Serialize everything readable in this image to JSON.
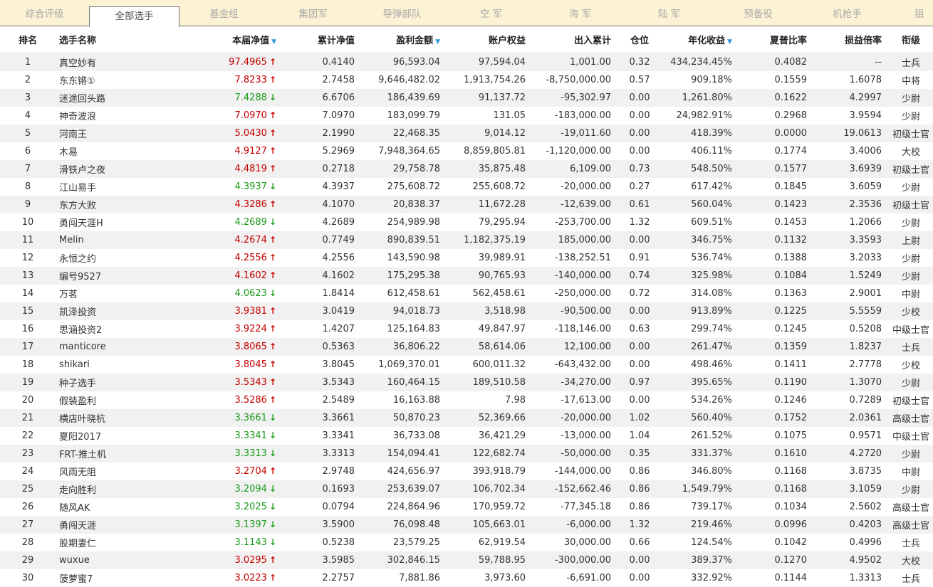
{
  "tabs": [
    {
      "label": "综合评级",
      "active": false
    },
    {
      "label": "全部选手",
      "active": true
    },
    {
      "label": "基金组",
      "active": false
    },
    {
      "label": "集团军",
      "active": false
    },
    {
      "label": "导弹部队",
      "active": false
    },
    {
      "label": "空 军",
      "active": false
    },
    {
      "label": "海 军",
      "active": false
    },
    {
      "label": "陆 军",
      "active": false
    },
    {
      "label": "预备役",
      "active": false
    },
    {
      "label": "机枪手",
      "active": false
    },
    {
      "label": "狙",
      "active": false
    }
  ],
  "table": {
    "columns": [
      "排名",
      "选手名称",
      "本届净值",
      "累计净值",
      "盈利金额",
      "账户权益",
      "出入累计",
      "仓位",
      "年化收益",
      "夏普比率",
      "损益倍率",
      "衔级"
    ],
    "sort_icon": "▼",
    "rows": [
      {
        "rank": "1",
        "name": "真空妙有",
        "nav": "97.4965",
        "dir": "up",
        "cum_nav": "0.4140",
        "profit": "96,593.04",
        "equity": "97,594.04",
        "flow": "1,001.00",
        "position": "0.32",
        "annual": "434,234.45%",
        "sharpe": "0.4082",
        "ratio": "--",
        "grade": "士兵"
      },
      {
        "rank": "2",
        "name": "东东锵①",
        "nav": "7.8233",
        "dir": "up",
        "cum_nav": "2.7458",
        "profit": "9,646,482.02",
        "equity": "1,913,754.26",
        "flow": "-8,750,000.00",
        "position": "0.57",
        "annual": "909.18%",
        "sharpe": "0.1559",
        "ratio": "1.6078",
        "grade": "中将"
      },
      {
        "rank": "3",
        "name": "迷途回头路",
        "nav": "7.4288",
        "dir": "down",
        "cum_nav": "6.6706",
        "profit": "186,439.69",
        "equity": "91,137.72",
        "flow": "-95,302.97",
        "position": "0.00",
        "annual": "1,261.80%",
        "sharpe": "0.1622",
        "ratio": "4.2997",
        "grade": "少尉"
      },
      {
        "rank": "4",
        "name": "神奇波浪",
        "nav": "7.0970",
        "dir": "up",
        "cum_nav": "7.0970",
        "profit": "183,099.79",
        "equity": "131.05",
        "flow": "-183,000.00",
        "position": "0.00",
        "annual": "24,982.91%",
        "sharpe": "0.2968",
        "ratio": "3.9594",
        "grade": "少尉"
      },
      {
        "rank": "5",
        "name": "河南王",
        "nav": "5.0430",
        "dir": "up",
        "cum_nav": "2.1990",
        "profit": "22,468.35",
        "equity": "9,014.12",
        "flow": "-19,011.60",
        "position": "0.00",
        "annual": "418.39%",
        "sharpe": "0.0000",
        "ratio": "19.0613",
        "grade": "初级士官"
      },
      {
        "rank": "6",
        "name": "木易",
        "nav": "4.9127",
        "dir": "up",
        "cum_nav": "5.2969",
        "profit": "7,948,364.65",
        "equity": "8,859,805.81",
        "flow": "-1,120,000.00",
        "position": "0.00",
        "annual": "406.11%",
        "sharpe": "0.1774",
        "ratio": "3.4006",
        "grade": "大校"
      },
      {
        "rank": "7",
        "name": "滑铁卢之夜",
        "nav": "4.4819",
        "dir": "up",
        "cum_nav": "0.2718",
        "profit": "29,758.78",
        "equity": "35,875.48",
        "flow": "6,109.00",
        "position": "0.73",
        "annual": "548.50%",
        "sharpe": "0.1577",
        "ratio": "3.6939",
        "grade": "初级士官"
      },
      {
        "rank": "8",
        "name": "江山易手",
        "nav": "4.3937",
        "dir": "down",
        "cum_nav": "4.3937",
        "profit": "275,608.72",
        "equity": "255,608.72",
        "flow": "-20,000.00",
        "position": "0.27",
        "annual": "617.42%",
        "sharpe": "0.1845",
        "ratio": "3.6059",
        "grade": "少尉"
      },
      {
        "rank": "9",
        "name": "东方大败",
        "nav": "4.3286",
        "dir": "up",
        "cum_nav": "4.1070",
        "profit": "20,838.37",
        "equity": "11,672.28",
        "flow": "-12,639.00",
        "position": "0.61",
        "annual": "560.04%",
        "sharpe": "0.1423",
        "ratio": "2.3536",
        "grade": "初级士官"
      },
      {
        "rank": "10",
        "name": "勇闯天涯H",
        "nav": "4.2689",
        "dir": "down",
        "cum_nav": "4.2689",
        "profit": "254,989.98",
        "equity": "79,295.94",
        "flow": "-253,700.00",
        "position": "1.32",
        "annual": "609.51%",
        "sharpe": "0.1453",
        "ratio": "1.2066",
        "grade": "少尉"
      },
      {
        "rank": "11",
        "name": "Melin",
        "nav": "4.2674",
        "dir": "up",
        "cum_nav": "0.7749",
        "profit": "890,839.51",
        "equity": "1,182,375.19",
        "flow": "185,000.00",
        "position": "0.00",
        "annual": "346.75%",
        "sharpe": "0.1132",
        "ratio": "3.3593",
        "grade": "上尉"
      },
      {
        "rank": "12",
        "name": "永恒之约",
        "nav": "4.2556",
        "dir": "up",
        "cum_nav": "4.2556",
        "profit": "143,590.98",
        "equity": "39,989.91",
        "flow": "-138,252.51",
        "position": "0.91",
        "annual": "536.74%",
        "sharpe": "0.1388",
        "ratio": "3.2033",
        "grade": "少尉"
      },
      {
        "rank": "13",
        "name": "编号9527",
        "nav": "4.1602",
        "dir": "up",
        "cum_nav": "4.1602",
        "profit": "175,295.38",
        "equity": "90,765.93",
        "flow": "-140,000.00",
        "position": "0.74",
        "annual": "325.98%",
        "sharpe": "0.1084",
        "ratio": "1.5249",
        "grade": "少尉"
      },
      {
        "rank": "14",
        "name": "万茗",
        "nav": "4.0623",
        "dir": "down",
        "cum_nav": "1.8414",
        "profit": "612,458.61",
        "equity": "562,458.61",
        "flow": "-250,000.00",
        "position": "0.72",
        "annual": "314.08%",
        "sharpe": "0.1363",
        "ratio": "2.9001",
        "grade": "中尉"
      },
      {
        "rank": "15",
        "name": "凯泽投资",
        "nav": "3.9381",
        "dir": "up",
        "cum_nav": "3.0419",
        "profit": "94,018.73",
        "equity": "3,518.98",
        "flow": "-90,500.00",
        "position": "0.00",
        "annual": "913.89%",
        "sharpe": "0.1225",
        "ratio": "5.5559",
        "grade": "少校"
      },
      {
        "rank": "16",
        "name": "思涵投资2",
        "nav": "3.9224",
        "dir": "up",
        "cum_nav": "1.4207",
        "profit": "125,164.83",
        "equity": "49,847.97",
        "flow": "-118,146.00",
        "position": "0.63",
        "annual": "299.74%",
        "sharpe": "0.1245",
        "ratio": "0.5208",
        "grade": "中级士官"
      },
      {
        "rank": "17",
        "name": "manticore",
        "nav": "3.8065",
        "dir": "up",
        "cum_nav": "0.5363",
        "profit": "36,806.22",
        "equity": "58,614.06",
        "flow": "12,100.00",
        "position": "0.00",
        "annual": "261.47%",
        "sharpe": "0.1359",
        "ratio": "1.8237",
        "grade": "士兵"
      },
      {
        "rank": "18",
        "name": "shikari",
        "nav": "3.8045",
        "dir": "up",
        "cum_nav": "3.8045",
        "profit": "1,069,370.01",
        "equity": "600,011.32",
        "flow": "-643,432.00",
        "position": "0.00",
        "annual": "498.46%",
        "sharpe": "0.1411",
        "ratio": "2.7778",
        "grade": "少校"
      },
      {
        "rank": "19",
        "name": "种子选手",
        "nav": "3.5343",
        "dir": "up",
        "cum_nav": "3.5343",
        "profit": "160,464.15",
        "equity": "189,510.58",
        "flow": "-34,270.00",
        "position": "0.97",
        "annual": "395.65%",
        "sharpe": "0.1190",
        "ratio": "1.3070",
        "grade": "少尉"
      },
      {
        "rank": "20",
        "name": "假装盈利",
        "nav": "3.5286",
        "dir": "up",
        "cum_nav": "2.5489",
        "profit": "16,163.88",
        "equity": "7.98",
        "flow": "-17,613.00",
        "position": "0.00",
        "annual": "534.26%",
        "sharpe": "0.1246",
        "ratio": "0.7289",
        "grade": "初级士官"
      },
      {
        "rank": "21",
        "name": "横店叶晓杭",
        "nav": "3.3661",
        "dir": "down",
        "cum_nav": "3.3661",
        "profit": "50,870.23",
        "equity": "52,369.66",
        "flow": "-20,000.00",
        "position": "1.02",
        "annual": "560.40%",
        "sharpe": "0.1752",
        "ratio": "2.0361",
        "grade": "高级士官"
      },
      {
        "rank": "22",
        "name": "夏阳2017",
        "nav": "3.3341",
        "dir": "down",
        "cum_nav": "3.3341",
        "profit": "36,733.08",
        "equity": "36,421.29",
        "flow": "-13,000.00",
        "position": "1.04",
        "annual": "261.52%",
        "sharpe": "0.1075",
        "ratio": "0.9571",
        "grade": "中级士官"
      },
      {
        "rank": "23",
        "name": "FRT-推土机",
        "nav": "3.3313",
        "dir": "down",
        "cum_nav": "3.3313",
        "profit": "154,094.41",
        "equity": "122,682.74",
        "flow": "-50,000.00",
        "position": "0.35",
        "annual": "331.37%",
        "sharpe": "0.1610",
        "ratio": "4.2720",
        "grade": "少尉"
      },
      {
        "rank": "24",
        "name": "风雨无阻",
        "nav": "3.2704",
        "dir": "up",
        "cum_nav": "2.9748",
        "profit": "424,656.97",
        "equity": "393,918.79",
        "flow": "-144,000.00",
        "position": "0.86",
        "annual": "346.80%",
        "sharpe": "0.1168",
        "ratio": "3.8735",
        "grade": "中尉"
      },
      {
        "rank": "25",
        "name": "走向胜利",
        "nav": "3.2094",
        "dir": "down",
        "cum_nav": "0.1693",
        "profit": "253,639.07",
        "equity": "106,702.34",
        "flow": "-152,662.46",
        "position": "0.86",
        "annual": "1,549.79%",
        "sharpe": "0.1168",
        "ratio": "3.1059",
        "grade": "少尉"
      },
      {
        "rank": "26",
        "name": "随风AK",
        "nav": "3.2025",
        "dir": "down",
        "cum_nav": "0.0794",
        "profit": "224,864.96",
        "equity": "170,959.72",
        "flow": "-77,345.18",
        "position": "0.86",
        "annual": "739.17%",
        "sharpe": "0.1034",
        "ratio": "2.5602",
        "grade": "高级士官"
      },
      {
        "rank": "27",
        "name": "勇闯天涯",
        "nav": "3.1397",
        "dir": "down",
        "cum_nav": "3.5900",
        "profit": "76,098.48",
        "equity": "105,663.01",
        "flow": "-6,000.00",
        "position": "1.32",
        "annual": "219.46%",
        "sharpe": "0.0996",
        "ratio": "0.4203",
        "grade": "高级士官"
      },
      {
        "rank": "28",
        "name": "股期妻仁",
        "nav": "3.1143",
        "dir": "down",
        "cum_nav": "0.5238",
        "profit": "23,579.25",
        "equity": "62,919.54",
        "flow": "30,000.00",
        "position": "0.66",
        "annual": "124.54%",
        "sharpe": "0.1042",
        "ratio": "0.4996",
        "grade": "士兵"
      },
      {
        "rank": "29",
        "name": "wuxue",
        "nav": "3.0295",
        "dir": "up",
        "cum_nav": "3.5985",
        "profit": "302,846.15",
        "equity": "59,788.95",
        "flow": "-300,000.00",
        "position": "0.00",
        "annual": "389.37%",
        "sharpe": "0.1270",
        "ratio": "4.9502",
        "grade": "大校"
      },
      {
        "rank": "30",
        "name": "菠萝蜜7",
        "nav": "3.0223",
        "dir": "up",
        "cum_nav": "2.2757",
        "profit": "7,881.86",
        "equity": "3,973.60",
        "flow": "-6,691.00",
        "position": "0.00",
        "annual": "332.92%",
        "sharpe": "0.1144",
        "ratio": "1.3313",
        "grade": "士兵"
      }
    ]
  },
  "icons": {
    "up": "arrow-up-icon",
    "down": "arrow-down-icon",
    "sort": "sort-desc-icon"
  },
  "colors": {
    "tabbar_bg": "#fbf3d3",
    "up": "#c40000",
    "down": "#1a9a1a",
    "row_stripe": "#f1f1f1",
    "sort_icon": "#3399dd"
  }
}
